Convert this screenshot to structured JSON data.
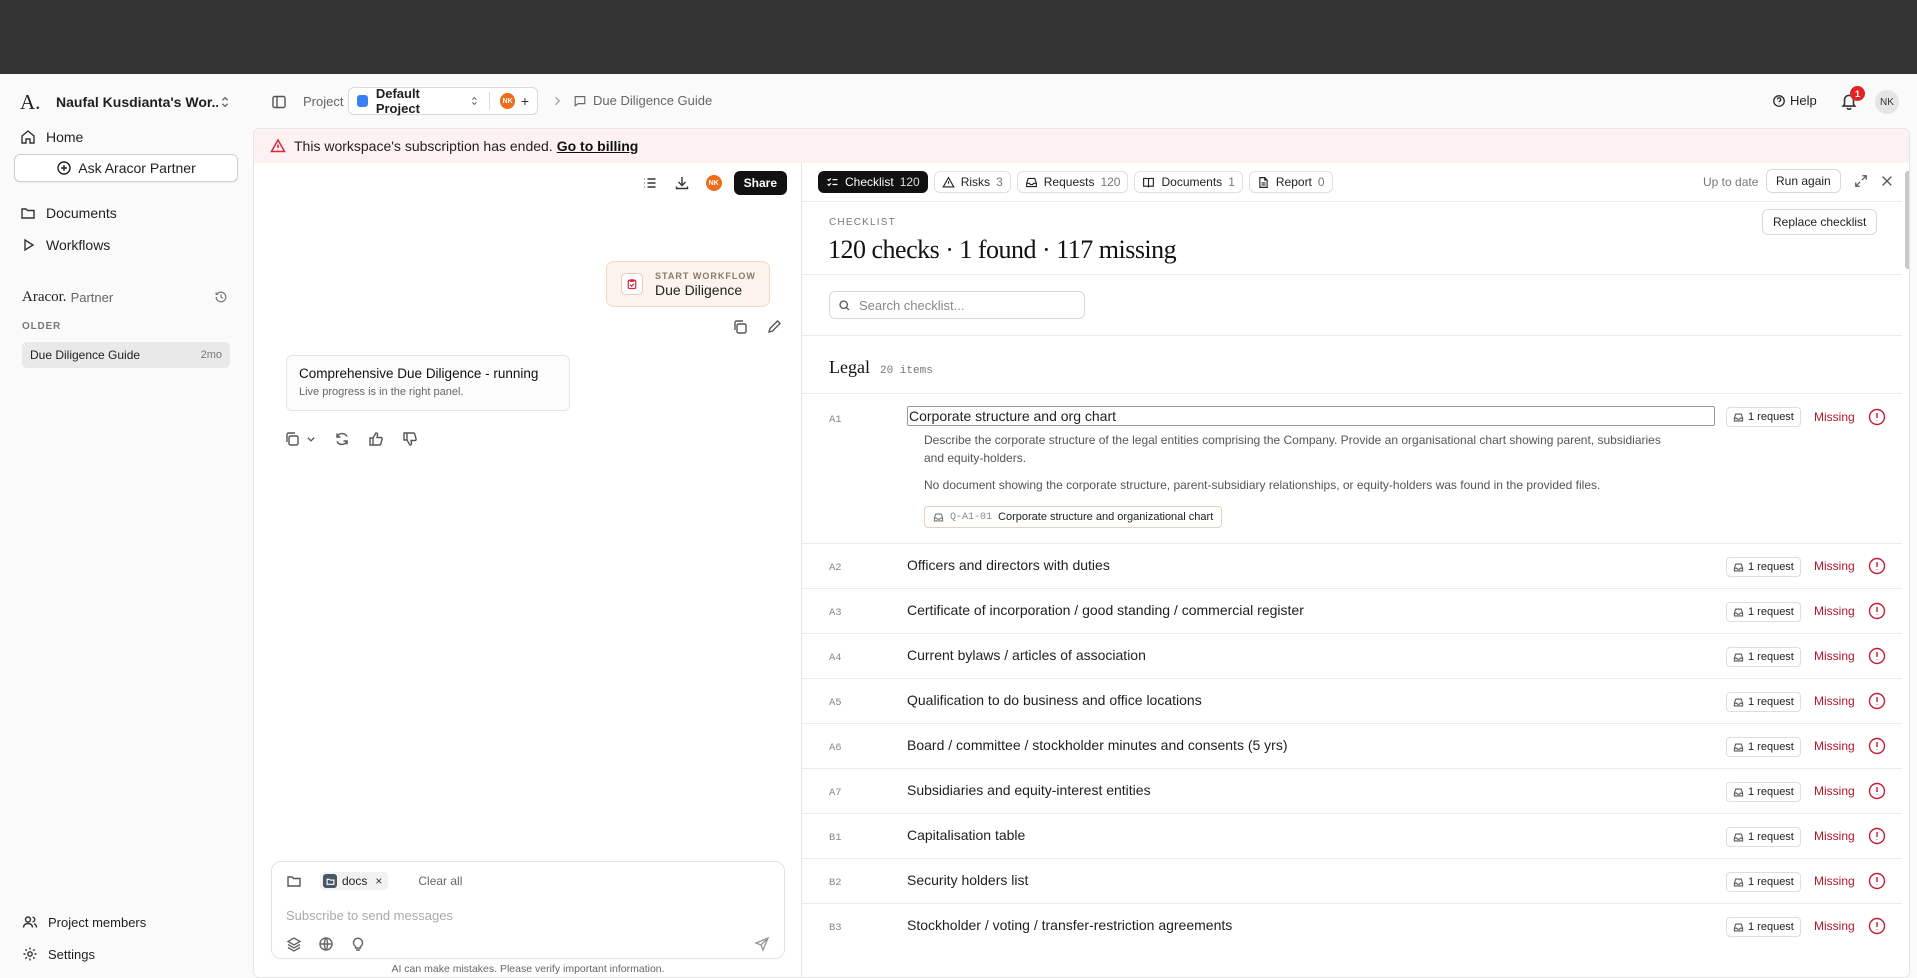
{
  "workspace": {
    "logo": "A.",
    "name": "Naufal Kusdianta's Wor..."
  },
  "sidebar": {
    "home": "Home",
    "ask": "Ask Aracor Partner",
    "documents": "Documents",
    "workflows": "Workflows",
    "partner_brand": "Aracor.",
    "partner_sub": "Partner",
    "older_label": "OLDER",
    "chats": [
      {
        "title": "Due Diligence Guide",
        "age": "2mo"
      }
    ],
    "project_members": "Project members",
    "settings": "Settings"
  },
  "header": {
    "project_label": "Project",
    "project_name": "Default Project",
    "project_avatar": "NK",
    "breadcrumb": "Due Diligence Guide",
    "help": "Help",
    "notifications": "1",
    "user_initials": "NK"
  },
  "banner": {
    "text": "This workspace's subscription has ended.",
    "link": "Go to billing"
  },
  "chat": {
    "avatar": "NK",
    "share": "Share",
    "workflow_label": "START WORKFLOW",
    "workflow_name": "Due Diligence",
    "status_title": "Comprehensive Due Diligence - running",
    "status_sub": "Live progress is in the right panel.",
    "chip": "docs",
    "chip_close": "×",
    "clear_all": "Clear all",
    "placeholder": "Subscribe to send messages",
    "disclaimer": "AI can make mistakes. Please verify important information."
  },
  "panel": {
    "tabs": [
      {
        "label": "Checklist",
        "count": "120"
      },
      {
        "label": "Risks",
        "count": "3"
      },
      {
        "label": "Requests",
        "count": "120"
      },
      {
        "label": "Documents",
        "count": "1"
      },
      {
        "label": "Report",
        "count": "0"
      }
    ],
    "up_to_date": "Up to date",
    "run_again": "Run again",
    "label": "CHECKLIST",
    "title": "120 checks · 1 found · 117 missing",
    "replace": "Replace checklist",
    "search_placeholder": "Search checklist...",
    "section": {
      "name": "Legal",
      "count": "20 items"
    },
    "expanded": {
      "code": "A1",
      "title": "Corporate structure and org chart",
      "desc": "Describe the corporate structure of the legal entities comprising the Company. Provide an organisational chart showing parent, subsidiaries and equity-holders.",
      "finding": "No document showing the corporate structure, parent-subsidiary relationships, or equity-holders was found in the provided files.",
      "ref_code": "Q-A1-01",
      "ref_title": "Corporate structure and organizational chart",
      "request": "1 request",
      "status": "Missing"
    },
    "rows": [
      {
        "code": "A2",
        "title": "Officers and directors with duties",
        "request": "1 request",
        "status": "Missing"
      },
      {
        "code": "A3",
        "title": "Certificate of incorporation / good standing / commercial register",
        "request": "1 request",
        "status": "Missing"
      },
      {
        "code": "A4",
        "title": "Current bylaws / articles of association",
        "request": "1 request",
        "status": "Missing"
      },
      {
        "code": "A5",
        "title": "Qualification to do business and office locations",
        "request": "1 request",
        "status": "Missing"
      },
      {
        "code": "A6",
        "title": "Board / committee / stockholder minutes and consents (5 yrs)",
        "request": "1 request",
        "status": "Missing"
      },
      {
        "code": "A7",
        "title": "Subsidiaries and equity-interest entities",
        "request": "1 request",
        "status": "Missing"
      },
      {
        "code": "B1",
        "title": "Capitalisation table",
        "request": "1 request",
        "status": "Missing"
      },
      {
        "code": "B2",
        "title": "Security holders list",
        "request": "1 request",
        "status": "Missing"
      },
      {
        "code": "B3",
        "title": "Stockholder / voting / transfer-restriction agreements",
        "request": "1 request",
        "status": "Missing"
      }
    ]
  }
}
